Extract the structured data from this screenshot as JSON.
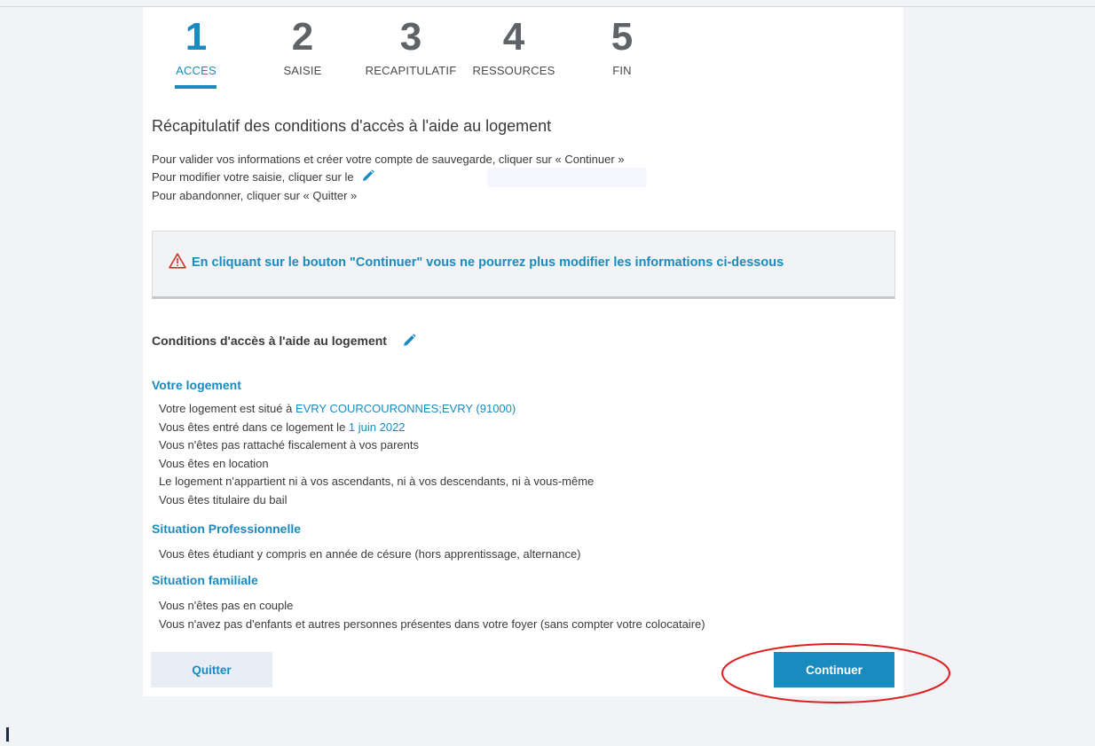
{
  "stepper": {
    "steps": [
      {
        "number": "1",
        "label": "ACCES",
        "active": true
      },
      {
        "number": "2",
        "label": "SAISIE",
        "active": false
      },
      {
        "number": "3",
        "label": "RECAPITULATIF",
        "active": false
      },
      {
        "number": "4",
        "label": "RESSOURCES",
        "active": false
      },
      {
        "number": "5",
        "label": "FIN",
        "active": false
      }
    ]
  },
  "page_title": "Récapitulatif des conditions d'accès à l'aide au logement",
  "intro": {
    "line1": "Pour valider vos informations et créer votre compte de sauvegarde, cliquer sur « Continuer »",
    "line2": "Pour modifier votre saisie, cliquer sur le",
    "line3": "Pour abandonner, cliquer sur « Quitter »"
  },
  "warning": {
    "text": "En cliquant sur le bouton \"Continuer\" vous ne pourrez plus modifier les informations ci-dessous",
    "icon": "warning-triangle-icon"
  },
  "conditions": {
    "title": "Conditions d'accès à l'aide au logement",
    "logement": {
      "title": "Votre logement",
      "situe_prefix": "Votre logement est situé à ",
      "situe_value": "EVRY COURCOURONNES;EVRY (91000)",
      "entree_prefix": "Vous êtes entré dans ce logement le ",
      "entree_value": "1 juin 2022",
      "rattache": "Vous n'êtes pas rattaché fiscalement à vos parents",
      "location": "Vous êtes en location",
      "appartient": "Le logement n'appartient ni à vos ascendants, ni à vos descendants, ni à vous-même",
      "titulaire": "Vous êtes titulaire du bail"
    },
    "professionnelle": {
      "title": "Situation Professionnelle",
      "line1": "Vous êtes étudiant y compris en année de césure (hors apprentissage, alternance)"
    },
    "familiale": {
      "title": "Situation familiale",
      "line1": "Vous n'êtes pas en couple",
      "line2": "Vous n'avez pas d'enfants et autres personnes présentes dans votre foyer (sans compter votre colocataire)"
    }
  },
  "buttons": {
    "quit": "Quitter",
    "continue": "Continuer"
  },
  "colors": {
    "accent": "#1a8bbf",
    "warning_icon": "#d0312d",
    "annotation": "#e01e1e"
  }
}
